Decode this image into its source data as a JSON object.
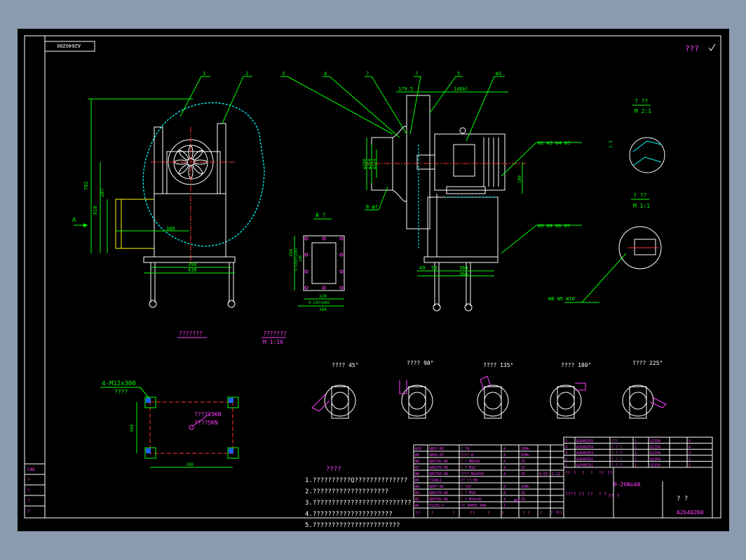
{
  "drawing_number": "A2640Z00",
  "title_mark": "???",
  "model": "9-26No4A",
  "callouts": [
    "1",
    "2",
    "3",
    "4",
    "?",
    "?",
    "5",
    "W1"
  ],
  "part_labels": {
    "w2_w5": "W2 W3 W4 W5",
    "w3_w7": "W3 W4 W6 W7",
    "w8_w10": "W8 W9 W10",
    "holes": "8-φ7"
  },
  "dimensions": {
    "d1": "782",
    "d2": "610",
    "d3": "287",
    "d4": "360",
    "d5": "390",
    "d6": "430",
    "top1": "179.5",
    "top2": "146bl",
    "d7": "49",
    "d8": "50",
    "d9": "360",
    "d10": "360",
    "dd1": "φ280",
    "dd2": "φ254",
    "dd3": "φ224",
    "side": "180",
    "flange_w": "128",
    "flange_b": "9-135=1065",
    "flange_bb": "184",
    "flange_h1": "250",
    "flange_h2": "180",
    "flange_h3": "5-135=(228)",
    "base_w": "390",
    "base_h": "349",
    "detail_dim": "2.5"
  },
  "views": {
    "view_a_arrow": "A",
    "view_a": "A ?",
    "detail_1": "? ??",
    "detail_1_scale": "M 2:1",
    "detail_2": "? ??",
    "detail_2_scale": "M 1:1",
    "label_front": "???????",
    "label_layout": "???????",
    "label_layout_scale": "M 1:16"
  },
  "orientations": [
    "???? 45°",
    "???? 90°",
    "???? 135°",
    "???? 180°",
    "???? 225°"
  ],
  "foundation": {
    "bolt": "4-M12x300",
    "bolt_note": "????",
    "load1": "????15KN",
    "load2": "????5KN"
  },
  "notes": {
    "title": "????",
    "items": [
      "1.??????????Q??????????????",
      "2.????????????????????",
      "3.??????????????????????????",
      "4.?????????????????????",
      "5.???????????????????????"
    ]
  },
  "bom": {
    "rows": [
      [
        "W10",
        "GB97-86",
        "? ?8",
        "4",
        "16Mn",
        ""
      ],
      [
        "W9",
        "GB93-87",
        "???? 8",
        "4",
        "65Mn",
        ""
      ],
      [
        "W8",
        "GB5782-86",
        "? ? M8X20",
        "4",
        "25",
        ""
      ],
      [
        "W7",
        "GB6170-86",
        "? ? M10",
        "4",
        "25",
        ""
      ],
      [
        "W6",
        "GB5783-86",
        "???? M10X50",
        "4",
        "25",
        "0.03",
        "1.12"
      ],
      [
        "W5",
        "Y100L1",
        "?? ??/3B",
        "",
        "",
        "",
        ""
      ],
      [
        "W4",
        "GB97-86",
        "? ?10",
        "8",
        "16Mn",
        ""
      ],
      [
        "W3",
        "GB6170-86",
        "? ? M10",
        "8",
        "25",
        ""
      ],
      [
        "W2",
        "GB5782-86",
        "? ? M10x45",
        "4",
        "25",
        ""
      ],
      [
        "W1",
        "Y132S-2",
        "?? 300V5.5KW",
        "1",
        "",
        "",
        ""
      ]
    ],
    "footer": [
      "??",
      "?",
      "?",
      "??",
      "?",
      "?",
      "? ?",
      "?",
      "? ?",
      "??"
    ],
    "parts": [
      [
        "5",
        "A2640Z02",
        "???",
        "1",
        "Q235A",
        "5"
      ],
      [
        "4",
        "A2640Z04",
        "? ? ?",
        "1",
        "Q235A",
        "4"
      ],
      [
        "3",
        "A2640Z03",
        "? ? ?",
        "1",
        "Q235A",
        "3"
      ],
      [
        "2",
        "A2640Z02",
        "? ? ?",
        "1",
        "Q235A",
        "2"
      ],
      [
        "1",
        "A2640Z01",
        "? ? ?",
        "1",
        "Q235A",
        "1"
      ]
    ],
    "tb_labels": [
      "??",
      "?",
      "?",
      "?",
      "??",
      "??",
      "???",
      "? ?",
      "? ?",
      "?",
      "? ?"
    ],
    "material": "?? ?",
    "weight": "87",
    "sheet": "? ?",
    "left_tabs": [
      "CAD",
      "?",
      "?",
      "?",
      "?"
    ]
  },
  "colors": {
    "cyan": "#00ffff",
    "green": "#00ff00",
    "white": "#ffffff",
    "magenta": "#ff40ff",
    "yellow": "#ffff00",
    "red": "#ff3030",
    "blue": "#2060ff"
  }
}
